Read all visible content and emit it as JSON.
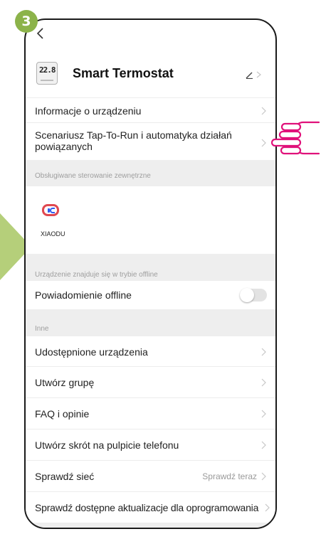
{
  "step_badge": "3",
  "header": {
    "device_title": "Smart Termostat",
    "device_icon_digits": "22.8"
  },
  "menu": {
    "device_info": "Informacje o urządzeniu",
    "tap_to_run": "Scenariusz Tap-To-Run i automatyka działań powiązanych"
  },
  "external_control": {
    "section_title": "Obsługiwane sterowanie zewnętrzne",
    "xiaodu_label": "XIAODU"
  },
  "offline": {
    "section_title": "Urządzenie znajduje się w trybie offline",
    "notification_label": "Powiadomienie offline",
    "notification_enabled": false
  },
  "other": {
    "section_title": "Inne",
    "shared_devices": "Udostępnione urządzenia",
    "create_group": "Utwórz grupę",
    "faq": "FAQ i opinie",
    "shortcut": "Utwórz skrót na pulpicie telefonu",
    "check_network": "Sprawdź sieć",
    "check_network_value": "Sprawdź teraz",
    "firmware_update": "Sprawdź dostępne aktualizacje dla oprogramowania"
  },
  "colors": {
    "accent_green": "#8cb34a",
    "hand_pink": "#e0117a",
    "xiaodu_red": "#e04850",
    "xiaodu_blue": "#2f5cf0"
  }
}
